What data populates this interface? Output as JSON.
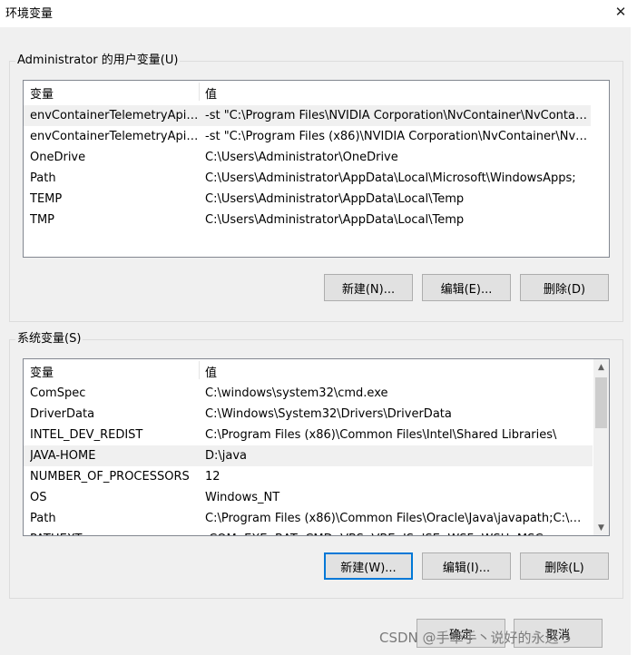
{
  "window": {
    "title": "环境变量",
    "close_glyph": "✕"
  },
  "user_vars": {
    "group_label": "Administrator 的用户变量(U)",
    "col_name": "变量",
    "col_value": "值",
    "rows": [
      {
        "name": "envContainerTelemetryApiC...",
        "value": "-st \"C:\\Program Files\\NVIDIA Corporation\\NvContainer\\NvContain..."
      },
      {
        "name": "envContainerTelemetryApiC...",
        "value": "-st \"C:\\Program Files (x86)\\NVIDIA Corporation\\NvContainer\\NvC..."
      },
      {
        "name": "OneDrive",
        "value": "C:\\Users\\Administrator\\OneDrive"
      },
      {
        "name": "Path",
        "value": "C:\\Users\\Administrator\\AppData\\Local\\Microsoft\\WindowsApps;"
      },
      {
        "name": "TEMP",
        "value": "C:\\Users\\Administrator\\AppData\\Local\\Temp"
      },
      {
        "name": "TMP",
        "value": "C:\\Users\\Administrator\\AppData\\Local\\Temp"
      }
    ],
    "buttons": {
      "new": "新建(N)...",
      "edit": "编辑(E)...",
      "delete": "删除(D)"
    }
  },
  "system_vars": {
    "group_label": "系统变量(S)",
    "col_name": "变量",
    "col_value": "值",
    "rows": [
      {
        "name": "ComSpec",
        "value": "C:\\windows\\system32\\cmd.exe"
      },
      {
        "name": "DriverData",
        "value": "C:\\Windows\\System32\\Drivers\\DriverData"
      },
      {
        "name": "INTEL_DEV_REDIST",
        "value": "C:\\Program Files (x86)\\Common Files\\Intel\\Shared Libraries\\"
      },
      {
        "name": "JAVA-HOME",
        "value": "D:\\java"
      },
      {
        "name": "NUMBER_OF_PROCESSORS",
        "value": "12"
      },
      {
        "name": "OS",
        "value": "Windows_NT"
      },
      {
        "name": "Path",
        "value": "C:\\Program Files (x86)\\Common Files\\Oracle\\Java\\javapath;C:\\wind..."
      },
      {
        "name": "PATHEXT",
        "value": ".COM;.EXE;.BAT;.CMD;.VBS;.VBE;.JS;.JSE;.WSF;.WSH;.MSC"
      }
    ],
    "buttons": {
      "new": "新建(W)...",
      "edit": "编辑(I)...",
      "delete": "删除(L)"
    },
    "scroll_up_glyph": "▲",
    "scroll_down_glyph": "▼"
  },
  "footer": {
    "ok": "确定",
    "cancel": "取消"
  },
  "watermark": "CSDN @手牵手丶说好的永远っ"
}
